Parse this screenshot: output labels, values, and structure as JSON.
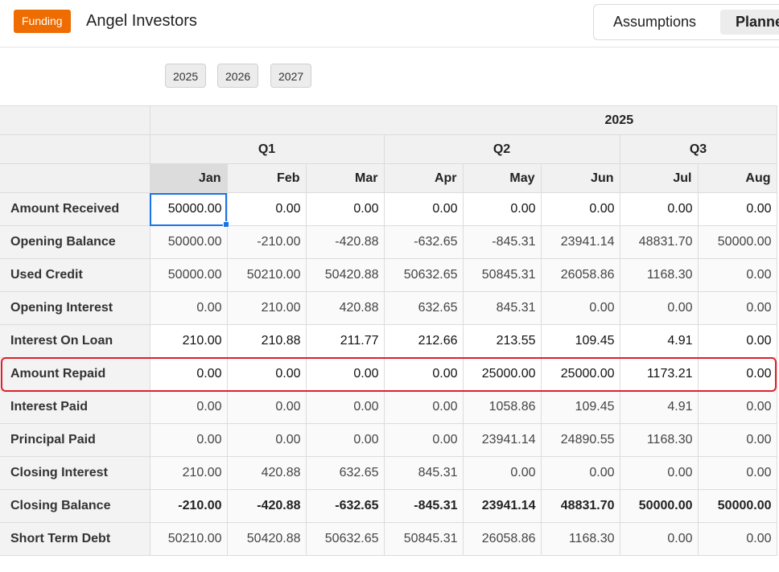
{
  "header": {
    "badge": "Funding",
    "title": "Angel Investors"
  },
  "tabs": [
    {
      "label": "Assumptions"
    },
    {
      "label": "Planne"
    }
  ],
  "years": [
    "2025",
    "2026",
    "2027"
  ],
  "table": {
    "year": "2025",
    "quarters": [
      "Q1",
      "Q2",
      "Q3"
    ],
    "months": [
      "Jan",
      "Feb",
      "Mar",
      "Apr",
      "May",
      "Jun",
      "Jul",
      "Aug"
    ],
    "rows": [
      {
        "label": "Amount Received",
        "values": [
          "50000.00",
          "0.00",
          "0.00",
          "0.00",
          "0.00",
          "0.00",
          "0.00",
          "0.00"
        ]
      },
      {
        "label": "Opening Balance",
        "values": [
          "50000.00",
          "-210.00",
          "-420.88",
          "-632.65",
          "-845.31",
          "23941.14",
          "48831.70",
          "50000.00"
        ]
      },
      {
        "label": "Used Credit",
        "values": [
          "50000.00",
          "50210.00",
          "50420.88",
          "50632.65",
          "50845.31",
          "26058.86",
          "1168.30",
          "0.00"
        ]
      },
      {
        "label": "Opening Interest",
        "values": [
          "0.00",
          "210.00",
          "420.88",
          "632.65",
          "845.31",
          "0.00",
          "0.00",
          "0.00"
        ]
      },
      {
        "label": "Interest On Loan",
        "values": [
          "210.00",
          "210.88",
          "211.77",
          "212.66",
          "213.55",
          "109.45",
          "4.91",
          "0.00"
        ]
      },
      {
        "label": "Amount Repaid",
        "values": [
          "0.00",
          "0.00",
          "0.00",
          "0.00",
          "25000.00",
          "25000.00",
          "1173.21",
          "0.00"
        ]
      },
      {
        "label": "Interest Paid",
        "values": [
          "0.00",
          "0.00",
          "0.00",
          "0.00",
          "1058.86",
          "109.45",
          "4.91",
          "0.00"
        ]
      },
      {
        "label": "Principal Paid",
        "values": [
          "0.00",
          "0.00",
          "0.00",
          "0.00",
          "23941.14",
          "24890.55",
          "1168.30",
          "0.00"
        ]
      },
      {
        "label": "Closing Interest",
        "values": [
          "210.00",
          "420.88",
          "632.65",
          "845.31",
          "0.00",
          "0.00",
          "0.00",
          "0.00"
        ]
      },
      {
        "label": "Closing Balance",
        "values": [
          "-210.00",
          "-420.88",
          "-632.65",
          "-845.31",
          "23941.14",
          "48831.70",
          "50000.00",
          "50000.00"
        ]
      },
      {
        "label": "Short Term Debt",
        "values": [
          "50210.00",
          "50420.88",
          "50632.65",
          "50845.31",
          "26058.86",
          "1168.30",
          "0.00",
          "0.00"
        ]
      }
    ]
  }
}
